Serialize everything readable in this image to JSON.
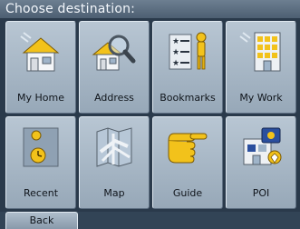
{
  "header": {
    "title": "Choose destination:"
  },
  "tiles": [
    {
      "label": "My Home",
      "icon": "home-icon"
    },
    {
      "label": "Address",
      "icon": "address-search-icon"
    },
    {
      "label": "Bookmarks",
      "icon": "bookmarks-icon"
    },
    {
      "label": "My Work",
      "icon": "work-building-icon"
    },
    {
      "label": "Recent",
      "icon": "recent-clock-icon"
    },
    {
      "label": "Map",
      "icon": "map-icon"
    },
    {
      "label": "Guide",
      "icon": "guide-pointing-hand-icon"
    },
    {
      "label": "POI",
      "icon": "poi-icon"
    }
  ],
  "footer": {
    "back_label": "Back"
  },
  "colors": {
    "tile": "#a9b8c6",
    "titlebar": "#5d6f82",
    "background": "#2a3a4b",
    "icon_yellow": "#f2c21b"
  }
}
